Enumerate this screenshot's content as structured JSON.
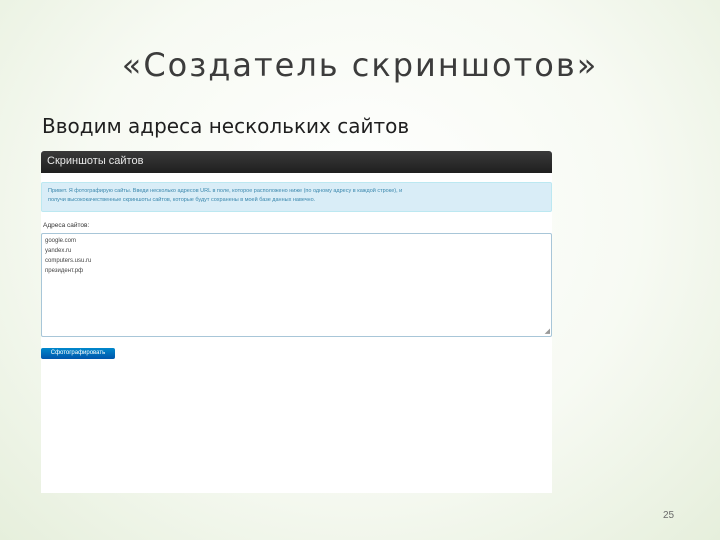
{
  "slide": {
    "title": "«Создатель скриншотов»",
    "subtitle": "Вводим адреса нескольких сайтов",
    "page_number": "25"
  },
  "screenshot": {
    "navbar_title": "Скриншоты сайтов",
    "alert_line1": "Привет. Я фотографирую сайты. Введи несколько адресов URL в поле, которое расположено ниже (по одному адресу в каждой строке), и",
    "alert_line2": "получи высококачественные скриншоты сайтов, которые будут сохранены в моей базе данных навечно.",
    "urls_label": "Адреса сайтов:",
    "urls": [
      "google.com",
      "yandex.ru",
      "computers.usu.ru",
      "президент.рф"
    ],
    "submit_label": "Сфотографировать"
  }
}
